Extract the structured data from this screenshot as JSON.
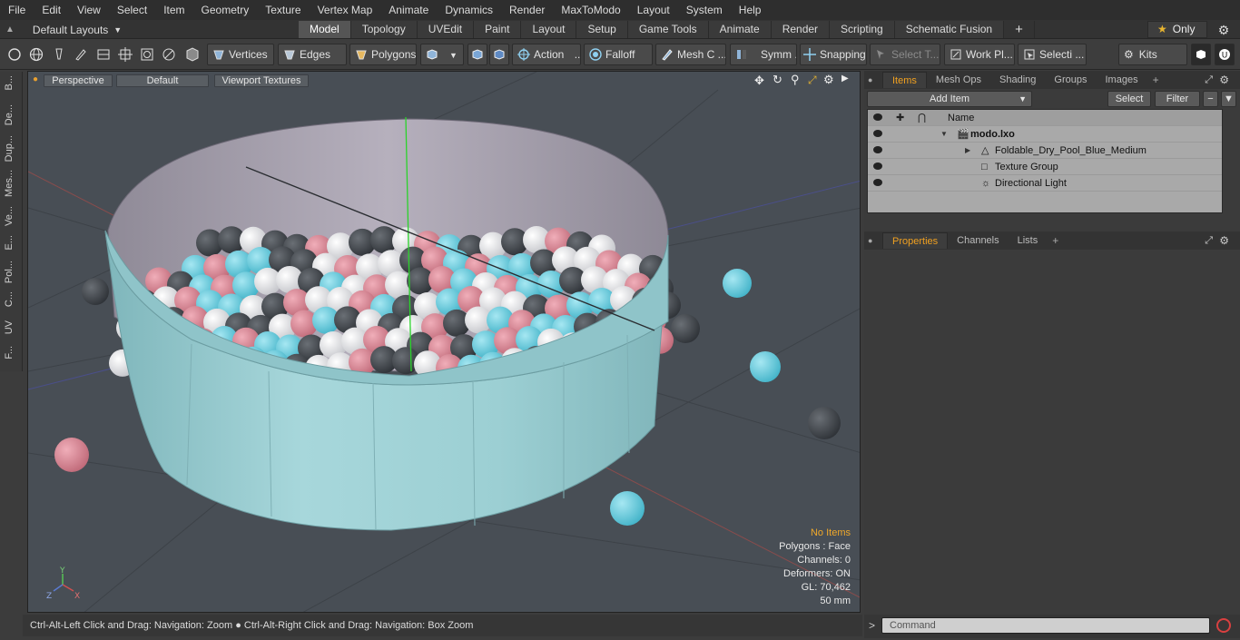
{
  "menu": [
    "File",
    "Edit",
    "View",
    "Select",
    "Item",
    "Geometry",
    "Texture",
    "Vertex Map",
    "Animate",
    "Dynamics",
    "Render",
    "MaxToModo",
    "Layout",
    "System",
    "Help"
  ],
  "layout_selector": "Default Layouts",
  "tabs": [
    {
      "label": "Model",
      "active": true
    },
    {
      "label": "Topology"
    },
    {
      "label": "UVEdit"
    },
    {
      "label": "Paint"
    },
    {
      "label": "Layout"
    },
    {
      "label": "Setup"
    },
    {
      "label": "Game Tools"
    },
    {
      "label": "Animate"
    },
    {
      "label": "Render"
    },
    {
      "label": "Scripting"
    },
    {
      "label": "Schematic Fusion"
    }
  ],
  "tabs_add": "+",
  "only_label": "Only",
  "toolbar": {
    "vertices": "Vertices",
    "edges": "Edges",
    "polygons": "Polygons",
    "action": "Action",
    "falloff": "Falloff",
    "mesh": "Mesh C ...",
    "symm": "Symm ...",
    "snapping": "Snapping",
    "select_t": "Select T...",
    "workpl": "Work Pl...",
    "selecti": "Selecti ...",
    "kits": "Kits"
  },
  "left_tabs": [
    "B...",
    "De...",
    "Dup...",
    "Mes...",
    "Ve...",
    "E...",
    "Pol...",
    "C...",
    "UV",
    "F..."
  ],
  "viewport": {
    "view": "Perspective",
    "style": "Default",
    "textures": "Viewport Textures",
    "info": {
      "no_items": "No Items",
      "polygons": "Polygons : Face",
      "channels": "Channels: 0",
      "deformers": "Deformers: ON",
      "gl": "GL: 70,462",
      "units": "50 mm"
    },
    "axis_y": "Y",
    "axis_z": "Z",
    "axis_x": "X"
  },
  "status": "Ctrl-Alt-Left Click and Drag: Navigation: Zoom ● Ctrl-Alt-Right Click and Drag: Navigation: Box Zoom",
  "items_panel": {
    "tabs": [
      {
        "label": "Items",
        "active": true
      },
      {
        "label": "Mesh Ops"
      },
      {
        "label": "Shading"
      },
      {
        "label": "Groups"
      },
      {
        "label": "Images"
      }
    ],
    "add_item": "Add Item",
    "select": "Select",
    "filter": "Filter",
    "column_name": "Name",
    "rows": [
      {
        "label": "modo.lxo",
        "bold": true
      },
      {
        "label": "Foldable_Dry_Pool_Blue_Medium"
      },
      {
        "label": "Texture Group"
      },
      {
        "label": "Directional Light"
      }
    ]
  },
  "properties_panel": {
    "tabs": [
      {
        "label": "Properties",
        "active": true
      },
      {
        "label": "Channels"
      },
      {
        "label": "Lists"
      }
    ]
  },
  "command_placeholder": "Command",
  "colors": {
    "accent": "#f0a020",
    "pool": "#9fd2d6",
    "ball_blue": "#5fc9dc",
    "ball_pink": "#d98693",
    "ball_white": "#e6e6e8",
    "ball_gray": "#4c5157"
  }
}
